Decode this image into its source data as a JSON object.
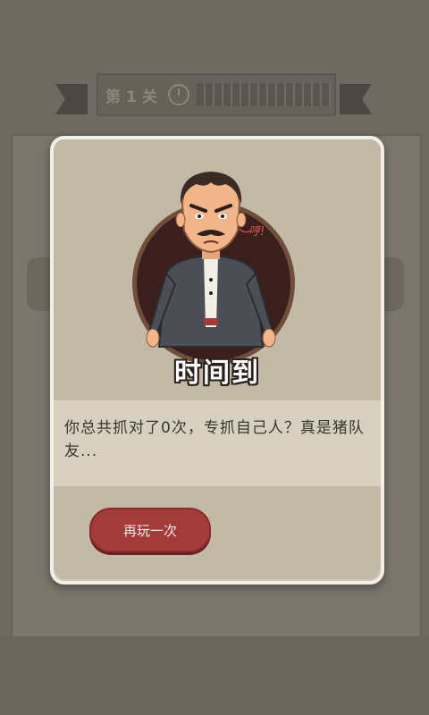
{
  "background": {
    "level_text": "第1关",
    "progress_value": 0
  },
  "modal": {
    "title": "时间到",
    "speech_bubble": "哼!",
    "message": "你总共抓对了0次，专抓自己人？真是猪队友...",
    "replay_label": "再玩一次"
  },
  "colors": {
    "modal_bg": "#c2b9a7",
    "message_band": "#d7d0c0",
    "button_red": "#a33b3b",
    "portrait_bg": "#3b1f1c"
  }
}
